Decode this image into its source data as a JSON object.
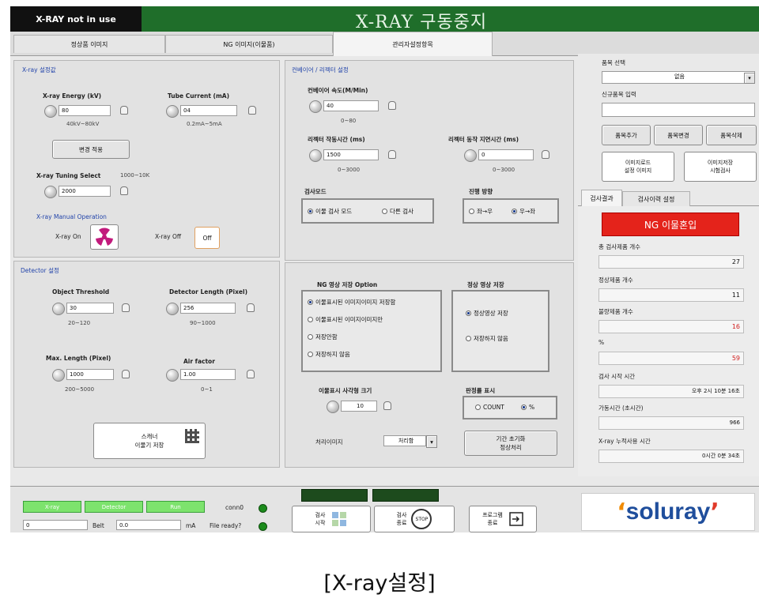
{
  "status_label": "X-RAY  not in use",
  "app_title": "X-RAY 구동중지",
  "tabs": [
    "정상품 이미지",
    "NG 이미지(이물품)",
    "관리자설정항목"
  ],
  "xray_settings": {
    "title": "X-ray 설정값",
    "energy_label": "X-ray Energy (kV)",
    "energy_value": "80",
    "energy_range": "40kV~80kV",
    "current_label": "Tube Current (mA)",
    "current_value": "04",
    "current_range": "0.2mA~5mA",
    "apply_button": "변경 적용",
    "timing_label": "X-ray Tuning Select",
    "timing_range": "1000~10K",
    "timing_value": "2000",
    "manual_title": "X-ray Manual Operation",
    "on_label": "X-ray On",
    "off_label": "X-ray Off",
    "off_button": "Off"
  },
  "detector": {
    "title": "Detector 설정",
    "object_threshold_label": "Object Threshold",
    "object_threshold_value": "30",
    "object_threshold_range": "20~120",
    "detector_length_label": "Detector Length (Pixel)",
    "detector_length_value": "256",
    "detector_length_range": "90~1000",
    "max_length_label": "Max. Length (Pixel)",
    "max_length_value": "1000",
    "max_length_range": "200~5000",
    "air_factor_label": "Air factor",
    "air_factor_value": "1.00",
    "air_factor_range": "0~1",
    "scan_button_line1": "스캐너",
    "scan_button_line2": "이물기 저장"
  },
  "conveyor": {
    "title": "컨베이어 / 리젝터 설정",
    "speed_label": "컨베이어 속도(M/Min)",
    "speed_value": "40",
    "speed_range": "0~80",
    "reject_time_label": "리젝터 작동시간 (ms)",
    "reject_time_value": "1500",
    "reject_time_range": "0~3000",
    "delay_label": "리젝터 동작 지연시간 (ms)",
    "delay_value": "0",
    "delay_range": "0~3000",
    "detect_group_title": "검사모드",
    "detect_opt1": "이물 검사 모드",
    "detect_opt2": "다른 검사",
    "dir_group_title": "진행 방향",
    "dir_opt1": "좌→우",
    "dir_opt2": "우→좌"
  },
  "ng_option": {
    "title": "NG 영상 저장 Option",
    "opt1": "이물표시된 이미지이미지 저장함",
    "opt2": "이물표시된 이미지이미지만",
    "opt3": "저장안함",
    "opt4": "저장하지 않음",
    "normal_title": "정상 영상 저장",
    "normal_opt1": "정상영상 저장",
    "normal_opt2": "저장하지 않음",
    "size_label": "이물표시 사각형 크기",
    "size_value": "10",
    "display_title": "판정률 표시",
    "display_opt1": "COUNT",
    "display_opt2": "%",
    "detect_label": "처리이미지",
    "detect_select": "처리함",
    "reset_line1": "기간 초기화",
    "reset_line2": "정상처리"
  },
  "sidebar": {
    "name_label": "품목 선택",
    "name_select": "없음",
    "new_label": "신규품목 입력",
    "new_value": "",
    "btn_add": "품목추가",
    "btn_edit": "품목변경",
    "btn_delete": "품목삭제",
    "btn_load_line1": "이미지로드",
    "btn_load_line2": "설정 이미지",
    "btn_save_line1": "이미지저장",
    "btn_save_line2": "시험검사",
    "tab1": "검사결과",
    "tab2": "검사이력 설정",
    "alarm": "NG 이물혼입",
    "total_label": "총 검사제품 개수",
    "total_value": "27",
    "ok_label": "정상제품 개수",
    "ok_value": "11",
    "ng_label": "불량제품 개수",
    "ng_value": "16",
    "ratio_label": "%",
    "ratio_value": "59",
    "start_label": "검사 시작 시간",
    "start_value": "오후 2시 10분 16초",
    "run_label": "가동시간 (초시간)",
    "run_value": "966",
    "xray_label": "X-ray 누적사용 시간",
    "xray_value": "0시간 0분 34초"
  },
  "bottom": {
    "led_xray": "X-ray",
    "led_detector": "Detector",
    "led_run": "Run",
    "conn_label": "conn0",
    "ready_label": "File ready?",
    "field1_value": "0",
    "unit1": "Belt",
    "field2_value": "0.0",
    "unit2": "mA",
    "start_label_line1": "검사",
    "start_label_line2": "시작",
    "stop_label_line1": "검사",
    "stop_label_line2": "종료",
    "stop_button": "STOP",
    "exit_label_line1": "프로그램",
    "exit_label_line2": "종료",
    "logo": "soluray"
  },
  "caption": "[X-ray설정]"
}
